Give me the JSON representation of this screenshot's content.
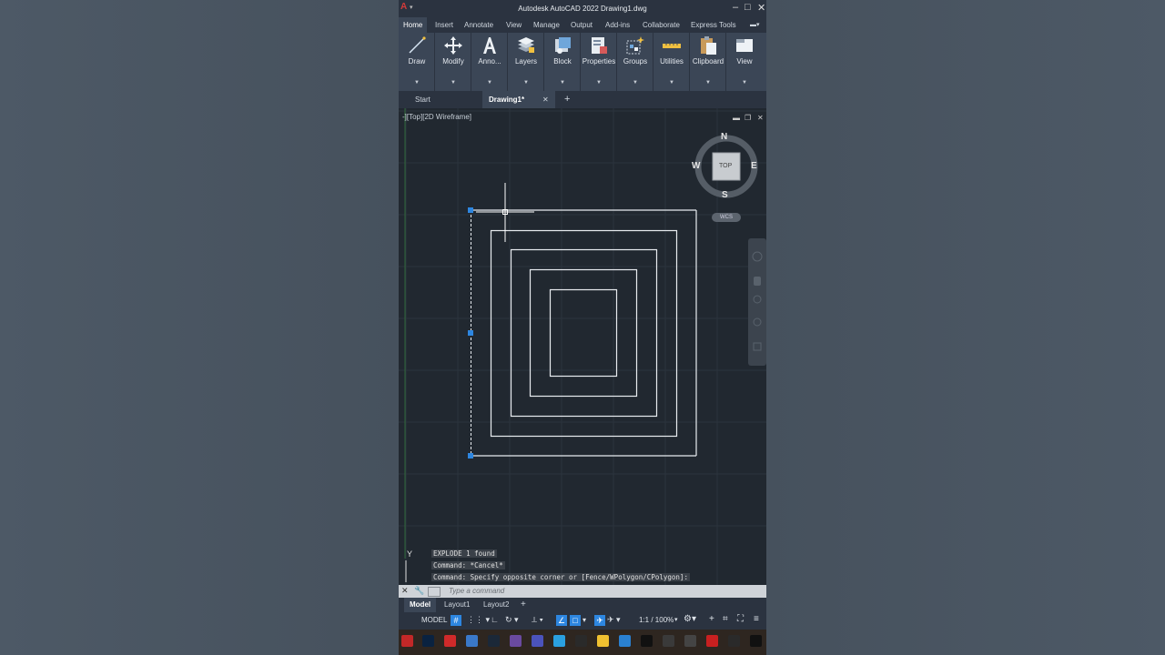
{
  "window": {
    "title": "Autodesk AutoCAD 2022    Drawing1.dwg",
    "logo": "A",
    "minimize": "–",
    "maximize": "□",
    "close": "✕"
  },
  "ribbon_tabs": [
    "Home",
    "Insert",
    "Annotate",
    "View",
    "Manage",
    "Output",
    "Add-ins",
    "Collaborate",
    "Express Tools"
  ],
  "ribbon_panels": [
    {
      "label": "Draw",
      "icon": "line-icon"
    },
    {
      "label": "Modify",
      "icon": "move-icon"
    },
    {
      "label": "Anno...",
      "icon": "text-icon"
    },
    {
      "label": "Layers",
      "icon": "layers-icon"
    },
    {
      "label": "Block",
      "icon": "block-icon"
    },
    {
      "label": "Properties",
      "icon": "properties-icon"
    },
    {
      "label": "Groups",
      "icon": "groups-icon"
    },
    {
      "label": "Utilities",
      "icon": "measure-icon"
    },
    {
      "label": "Clipboard",
      "icon": "clipboard-icon"
    },
    {
      "label": "View",
      "icon": "view-icon"
    }
  ],
  "doc_tabs": {
    "start": "Start",
    "active": "Drawing1*",
    "close": "✕",
    "add": "+"
  },
  "viewport": {
    "label": "-][Top][2D Wireframe]",
    "viewcube": {
      "n": "N",
      "s": "S",
      "e": "E",
      "w": "W",
      "face": "TOP",
      "wcs": "WCS"
    },
    "ucs_y": "Y"
  },
  "command_history": [
    "EXPLODE 1 found",
    "Command: *Cancel*",
    "Command: Specify opposite corner or [Fence/WPolygon/CPolygon]:"
  ],
  "command_input": {
    "placeholder": "Type a command"
  },
  "layout_tabs": {
    "model": "Model",
    "layout1": "Layout1",
    "layout2": "Layout2",
    "add": "+"
  },
  "status_bar": {
    "model": "MODEL",
    "scale": "1:1 / 100%"
  },
  "colors": {
    "accent": "#2d86e0",
    "background": "#212830",
    "ribbon": "#3b4656"
  }
}
